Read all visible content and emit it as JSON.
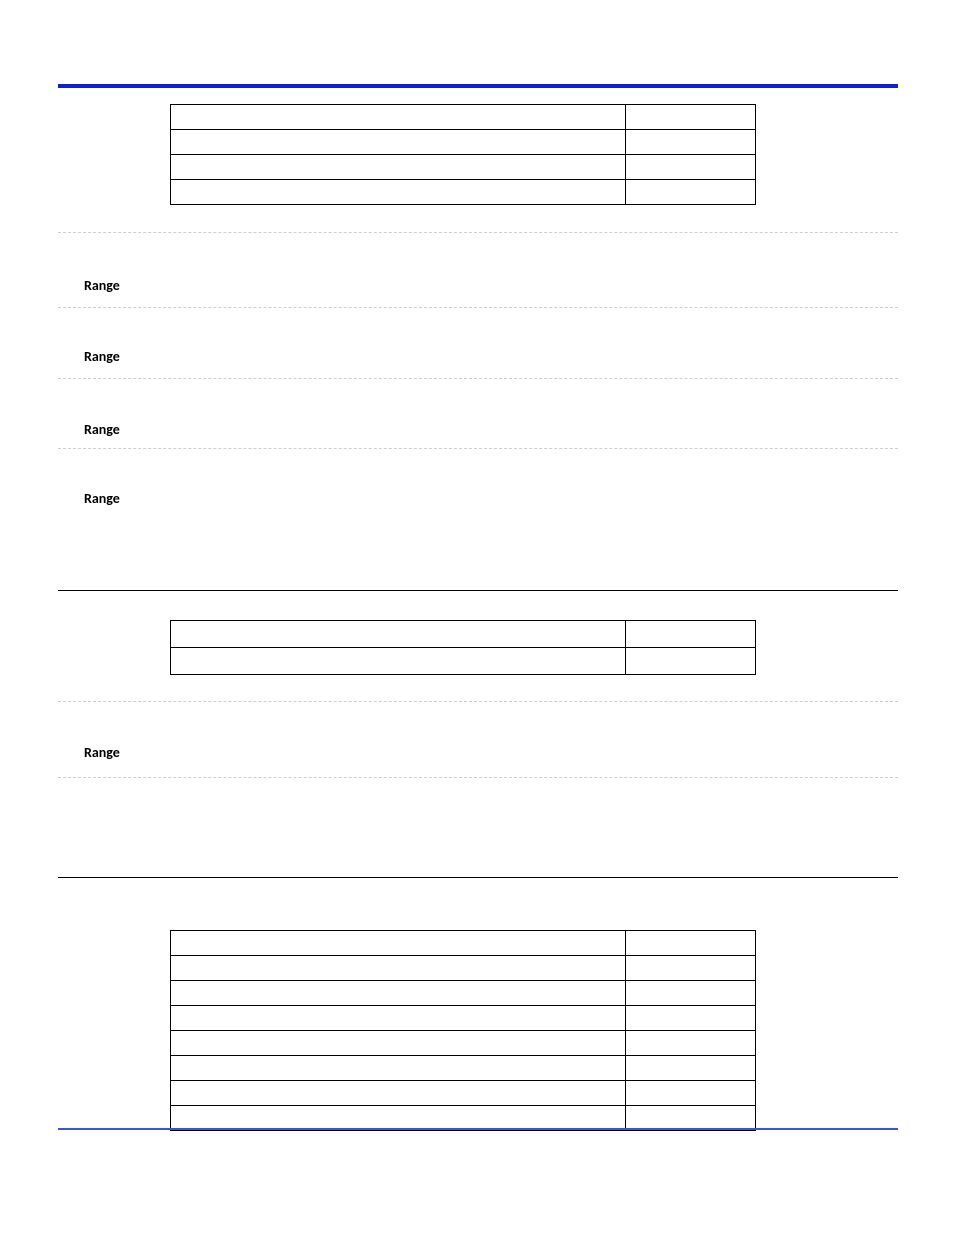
{
  "labels": {
    "range": "Range"
  },
  "section1": {
    "headings": [
      "Range",
      "Range",
      "Range",
      "Range"
    ],
    "table": {
      "rows": 4,
      "cols": 2
    }
  },
  "section2": {
    "headings": [
      "Range"
    ],
    "table": {
      "rows": 2,
      "cols": 2
    }
  },
  "section3": {
    "headings": [],
    "table": {
      "rows": 8,
      "cols": 2
    }
  }
}
